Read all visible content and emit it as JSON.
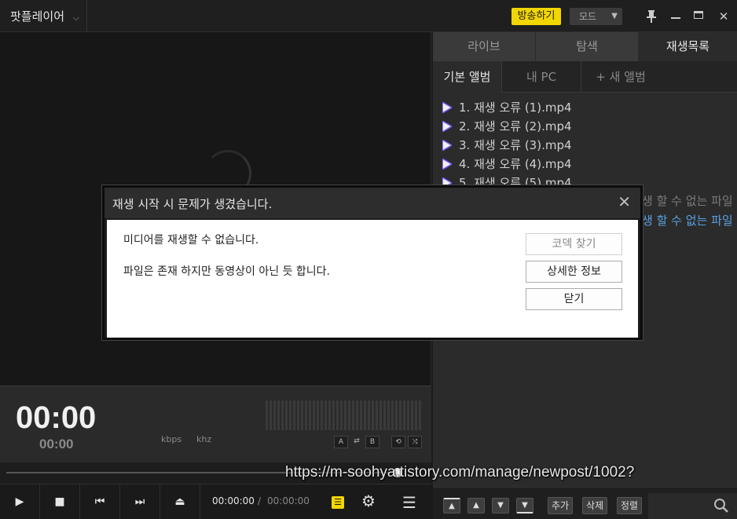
{
  "app": {
    "title": "팟플레이어",
    "title_chevron": "⌵"
  },
  "titlebar": {
    "broadcast_label": "방송하기",
    "mode_label": "모드",
    "mode_arrow": "▼",
    "pin_icon": "pin-icon",
    "pin_glyph": "📌",
    "minimize_glyph": "▁",
    "maximize_glyph": "▭",
    "close_glyph": "✕"
  },
  "info": {
    "time_main": "00:00",
    "time_sub": "00:00",
    "kbps": "kbps",
    "khz": "khz",
    "btn_a": "A",
    "btn_loop": "⇄",
    "btn_b": "B",
    "btn_repeat": "⟲",
    "btn_shuffle": "⤨"
  },
  "seek": {
    "progress": 0.0
  },
  "controls": {
    "play": "▶",
    "stop": "■",
    "prev": "⏮",
    "next": "⏭",
    "eject": "⏏",
    "current_time": "00:00:00",
    "separator": "/",
    "total_time": "00:00:00",
    "playlist_glyph": "☰",
    "settings_glyph": "⚙",
    "menu_glyph": "☰"
  },
  "right_panel": {
    "tabs": [
      {
        "label": "라이브",
        "active": false
      },
      {
        "label": "탐색",
        "active": false
      },
      {
        "label": "재생목록",
        "active": true
      }
    ],
    "sub_tabs": [
      {
        "label": "기본 앨범",
        "active": true
      },
      {
        "label": "내 PC",
        "active": false
      },
      {
        "label": "+ 새 앨범",
        "active": false
      }
    ],
    "playlist": [
      "1. 재생 오류 (1).mp4",
      "2. 재생 오류 (2).mp4",
      "3. 재생 오류 (3).mp4",
      "4. 재생 오류 (4).mp4",
      "5. 재생 오류 (5).mp4"
    ],
    "error_line_1": "생 할 수 없는 파일",
    "error_line_2": "생 할 수 없는 파일",
    "toolbar": {
      "top": "▲",
      "up": "▲",
      "down": "▼",
      "bottom": "▼",
      "add": "추가",
      "delete": "삭제",
      "sort": "정렬",
      "search_glyph": "⌕"
    }
  },
  "watermark": "https://m-soohya.tistory.com/manage/newpost/1002?",
  "dialog": {
    "title": "재생 시작 시 문제가 생겼습니다.",
    "close_glyph": "✕",
    "message_1": "미디어를 재생할 수 없습니다.",
    "message_2": "파일은 존재 하지만 동영상이 아닌 듯 합니다.",
    "buttons": {
      "codec": "코덱 찾기",
      "details": "상세한 정보",
      "close": "닫기"
    }
  },
  "colors": {
    "accent_yellow": "#f2d600",
    "error_link": "#5aa0e0",
    "play_icon_purple": "#7a55ff"
  }
}
